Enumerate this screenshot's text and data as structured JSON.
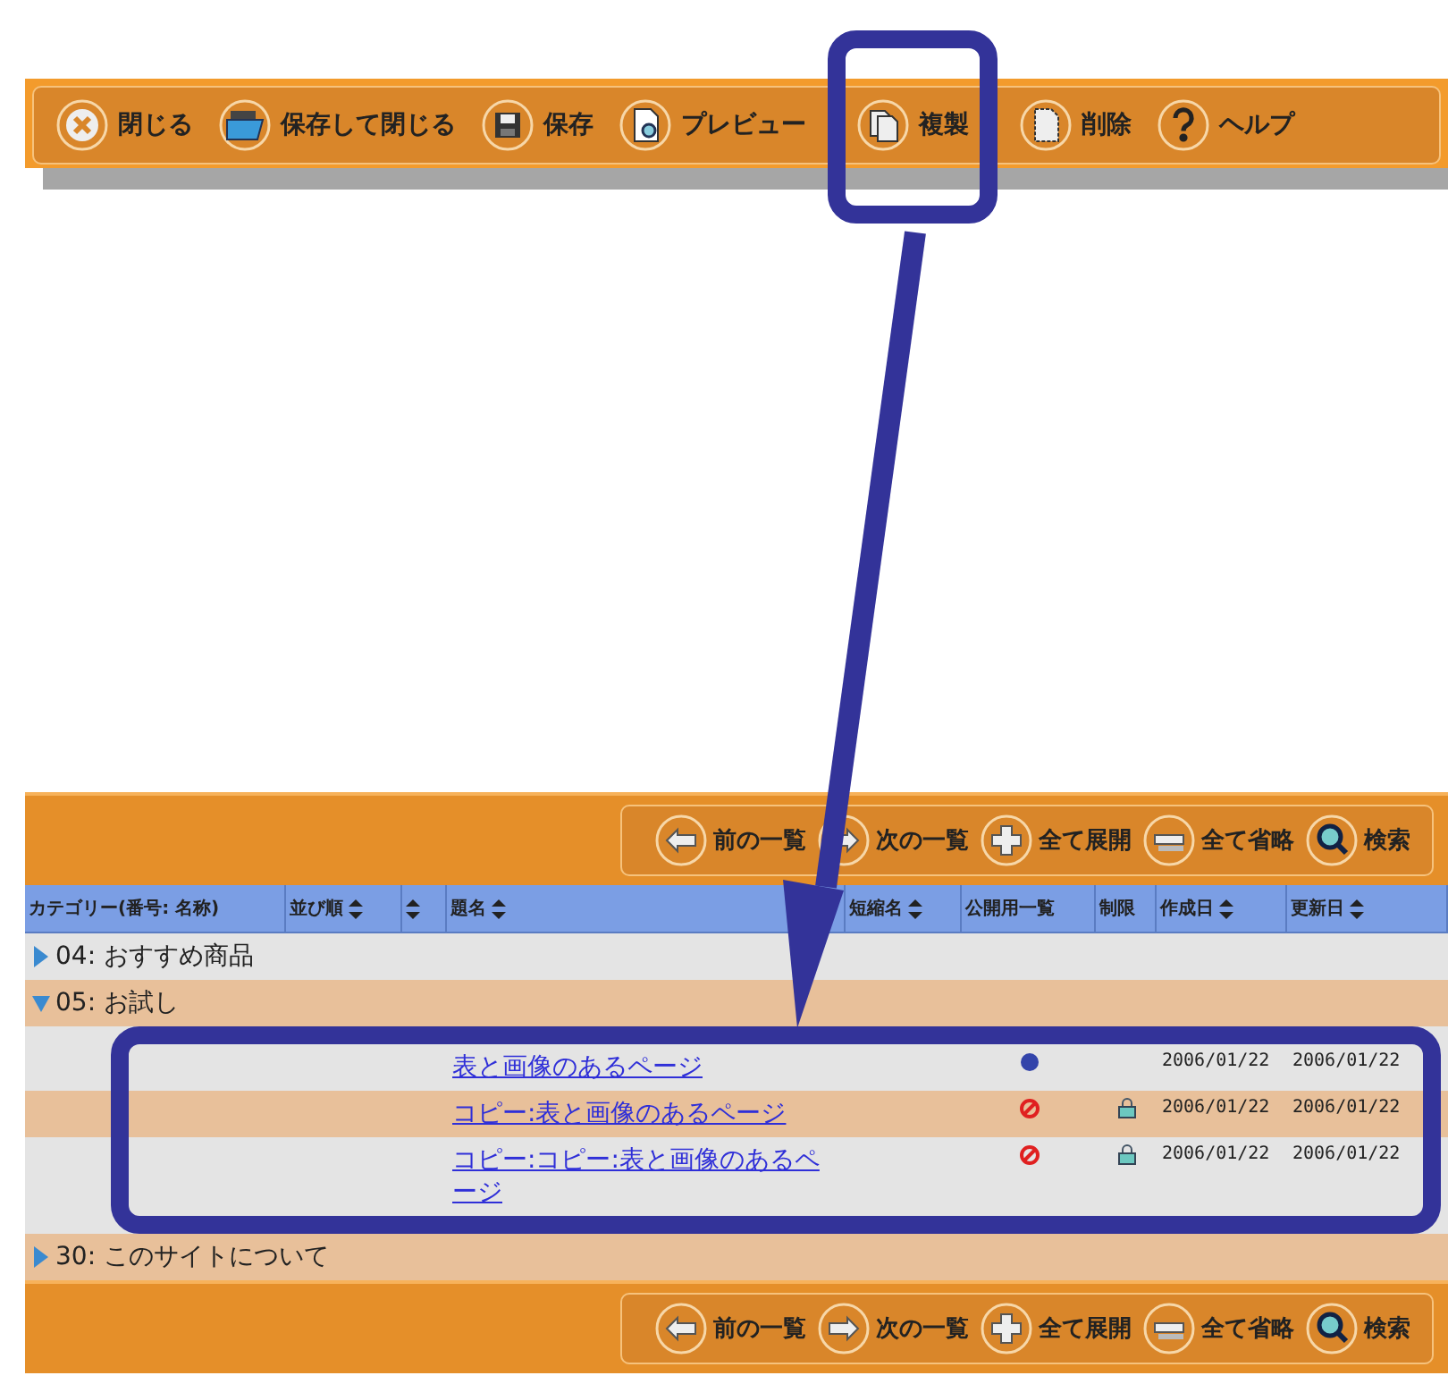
{
  "toolbar": {
    "buttons": [
      {
        "kind": "close",
        "label": "閉じる"
      },
      {
        "kind": "save-close",
        "label": "保存して閉じる"
      },
      {
        "kind": "save",
        "label": "保存"
      },
      {
        "kind": "preview",
        "label": "プレビュー"
      },
      {
        "kind": "copy",
        "label": "複製",
        "highlighted": true
      },
      {
        "kind": "delete",
        "label": "削除"
      },
      {
        "kind": "help",
        "label": "ヘルプ"
      }
    ]
  },
  "list": {
    "top_nav": [
      {
        "kind": "prev",
        "label": "前の一覧"
      },
      {
        "kind": "next",
        "label": "次の一覧"
      },
      {
        "kind": "expand",
        "label": "全て展開"
      },
      {
        "kind": "collapse",
        "label": "全て省略"
      },
      {
        "kind": "search",
        "label": "検索"
      }
    ],
    "columns": [
      {
        "label": "カテゴリー(番号: 名称)",
        "sortable": false
      },
      {
        "label": "並び順",
        "sortable": true
      },
      {
        "sortable": true
      },
      {
        "label": "題名",
        "sortable": true
      },
      {
        "label": "短縮名",
        "sortable": true
      },
      {
        "label": "公開用一覧",
        "sortable": false
      },
      {
        "label": "制限",
        "sortable": false
      },
      {
        "label": "作成日",
        "sortable": true
      },
      {
        "label": "更新日",
        "sortable": true
      }
    ],
    "categories": [
      {
        "label": "04: おすすめ商品",
        "expanded": false
      },
      {
        "label": "05: お試し",
        "expanded": true,
        "children": [
          {
            "title": "表と画像のあるページ",
            "published": true,
            "restricted": false,
            "created": "2006/01/22",
            "updated": "2006/01/22"
          },
          {
            "title": "コピー:表と画像のあるページ",
            "published": false,
            "restricted": true,
            "created": "2006/01/22",
            "updated": "2006/01/22"
          },
          {
            "title": "コピー:コピー:表と画像のあるページ",
            "published": false,
            "restricted": true,
            "created": "2006/01/22",
            "updated": "2006/01/22"
          }
        ]
      },
      {
        "label": "30: このサイトについて",
        "expanded": false
      }
    ],
    "bottom_nav": [
      {
        "kind": "prev",
        "label": "前の一覧"
      },
      {
        "kind": "next",
        "label": "次の一覧"
      },
      {
        "kind": "expand",
        "label": "全て展開"
      },
      {
        "kind": "collapse",
        "label": "全て省略"
      },
      {
        "kind": "search",
        "label": "検索"
      }
    ]
  }
}
